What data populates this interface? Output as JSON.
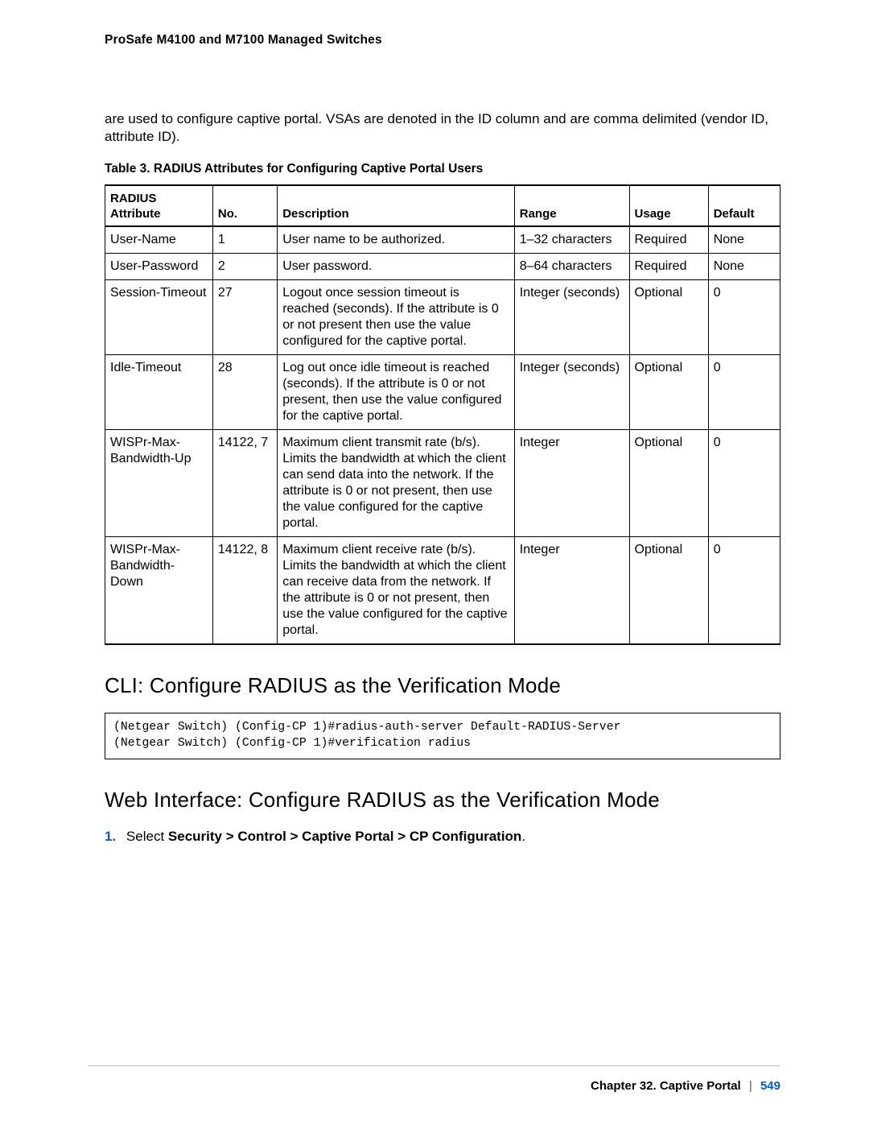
{
  "header": {
    "title": "ProSafe M4100 and M7100 Managed Switches"
  },
  "intro": "are used to configure captive portal. VSAs are denoted in the ID column and are comma delimited (vendor ID, attribute ID).",
  "table": {
    "caption": "Table 3.  RADIUS Attributes for Configuring Captive Portal Users",
    "headers": [
      "RADIUS Attribute",
      "No.",
      "Description",
      "Range",
      "Usage",
      "Default"
    ],
    "rows": [
      {
        "attr": "User-Name",
        "no": "1",
        "desc": "User name to be authorized.",
        "range": "1–32 characters",
        "usage": "Required",
        "def": "None"
      },
      {
        "attr": "User-Password",
        "no": "2",
        "desc": "User password.",
        "range": "8–64 characters",
        "usage": "Required",
        "def": "None"
      },
      {
        "attr": "Session-Timeout",
        "no": "27",
        "desc": "Logout once session timeout is reached (seconds). If the attribute is 0 or not present then use the value configured for the captive portal.",
        "range": "Integer (seconds)",
        "usage": "Optional",
        "def": "0"
      },
      {
        "attr": "Idle-Timeout",
        "no": "28",
        "desc": "Log out once idle timeout is reached (seconds). If the attribute is 0 or not present, then use the value configured for the captive portal.",
        "range": "Integer (seconds)",
        "usage": "Optional",
        "def": "0"
      },
      {
        "attr": "WISPr-Max-Bandwidth-Up",
        "no": "14122, 7",
        "desc": "Maximum client transmit rate (b/s). Limits the bandwidth at which the client can send data into the network. If the attribute is 0 or not present, then use the value configured for the captive portal.",
        "range": "Integer",
        "usage": "Optional",
        "def": "0"
      },
      {
        "attr": "WISPr-Max-Bandwidth-Down",
        "no": "14122, 8",
        "desc": "Maximum client receive rate (b/s). Limits the bandwidth at which the client can receive data from the network. If the attribute is 0 or not present, then use the value configured for the captive portal.",
        "range": "Integer",
        "usage": "Optional",
        "def": "0"
      }
    ]
  },
  "cli": {
    "heading": "CLI: Configure RADIUS as the Verification Mode",
    "lines": [
      "(Netgear Switch) (Config-CP 1)#radius-auth-server Default-RADIUS-Server",
      "(Netgear Switch) (Config-CP 1)#verification radius"
    ]
  },
  "web": {
    "heading": "Web Interface: Configure RADIUS as the Verification Mode",
    "step_num": "1.",
    "step_prefix": "Select ",
    "step_bold": "Security > Control > Captive Portal > CP Configuration",
    "step_suffix": "."
  },
  "footer": {
    "chapter": "Chapter 32.  Captive Portal",
    "page": "549"
  }
}
